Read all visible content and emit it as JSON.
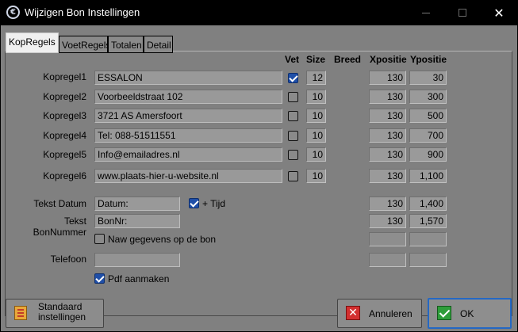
{
  "window": {
    "title": "Wijzigen Bon Instellingen",
    "icon": "app-logo-icon"
  },
  "tabs": [
    {
      "label": "KopRegels",
      "active": true
    },
    {
      "label": "VoetRegels",
      "active": false
    },
    {
      "label": "Totalen",
      "active": false
    },
    {
      "label": "Detail",
      "active": false
    }
  ],
  "headers": {
    "vet": "Vet",
    "size": "Size",
    "breed": "Breed",
    "xpositie": "Xpositie",
    "ypositie": "Ypositie"
  },
  "rows": [
    {
      "label": "Kopregel1",
      "value": "ESSALON",
      "vet": true,
      "size": "12",
      "x": "130",
      "y": "30"
    },
    {
      "label": "Kopregel2",
      "value": "Voorbeeldstraat 102",
      "vet": false,
      "size": "10",
      "x": "130",
      "y": "300"
    },
    {
      "label": "Kopregel3",
      "value": "3721 AS  Amersfoort",
      "vet": false,
      "size": "10",
      "x": "130",
      "y": "500"
    },
    {
      "label": "Kopregel4",
      "value": "Tel: 088-51511551",
      "vet": false,
      "size": "10",
      "x": "130",
      "y": "700"
    },
    {
      "label": "Kopregel5",
      "value": "Info@emailadres.nl",
      "vet": false,
      "size": "10",
      "x": "130",
      "y": "900"
    },
    {
      "label": "Kopregel6",
      "value": "www.plaats-hier-u-website.nl",
      "vet": false,
      "size": "10",
      "x": "130",
      "y": "1,100"
    }
  ],
  "tekst_datum": {
    "label": "Tekst Datum",
    "value": "Datum:",
    "tijd_label": "+ Tijd",
    "tijd_checked": true,
    "x": "130",
    "y": "1,400"
  },
  "tekst_bonnummer": {
    "label": "Tekst BonNummer",
    "value": "BonNr:",
    "x": "130",
    "y": "1,570"
  },
  "naw": {
    "label": "Naw gegevens op de bon",
    "checked": false,
    "x": "",
    "y": ""
  },
  "telefoon": {
    "label": "Telefoon",
    "value": "",
    "x": "",
    "y": ""
  },
  "pdf": {
    "label": "Pdf aanmaken",
    "checked": true
  },
  "buttons": {
    "standaard": "Standaard instellingen",
    "annuleren": "Annuleren",
    "ok": "OK"
  },
  "colors": {
    "accent": "#1f4fa8",
    "default_button_border": "#2468c4",
    "cancel_icon": "#d32f2f",
    "ok_icon": "#2e9d3a"
  }
}
